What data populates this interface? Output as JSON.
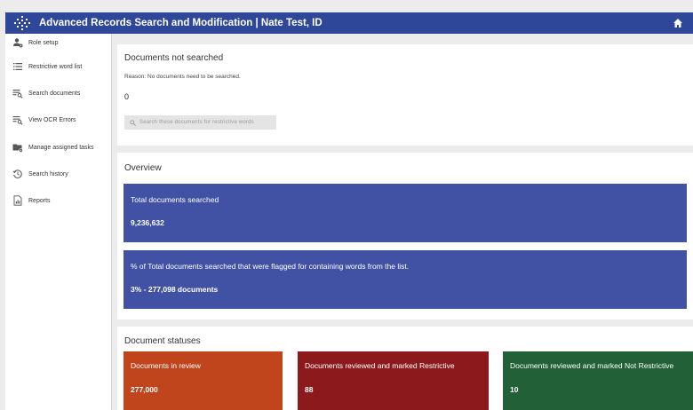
{
  "header": {
    "title": "Advanced Records Search and Modification | Nate Test, ID",
    "logo_icon": "sparkle-logo-icon",
    "home_icon": "home-icon",
    "color": "#2f4799"
  },
  "sidebar": {
    "items": [
      {
        "label": "Role setup",
        "icon": "user-settings-icon"
      },
      {
        "label": "Restrictive word list",
        "icon": "list-icon"
      },
      {
        "label": "Search documents",
        "icon": "search-list-icon"
      },
      {
        "label": "View OCR Errors",
        "icon": "search-list-icon"
      },
      {
        "label": "Manage assigned tasks",
        "icon": "folder-settings-icon"
      },
      {
        "label": "Search history",
        "icon": "history-icon"
      },
      {
        "label": "Reports",
        "icon": "report-icon"
      }
    ]
  },
  "not_searched": {
    "title": "Documents not searched",
    "reason": "Reason: No documents need to be searched.",
    "count": "0",
    "button_label": "Search these documents for restrictive words"
  },
  "overview": {
    "title": "Overview",
    "total_label": "Total documents searched",
    "total_value": "9,236,632",
    "flagged_label": "% of Total documents searched that were flagged for containing words from the list.",
    "flagged_value": "3% - 277,098 documents",
    "color": "#4152a5"
  },
  "statuses": {
    "title": "Document statuses",
    "items": [
      {
        "label": "Documents in review",
        "value": "277,000",
        "color": "#c0451c"
      },
      {
        "label": "Documents reviewed and marked Restrictive",
        "value": "88",
        "color": "#8c1a1c"
      },
      {
        "label": "Documents reviewed and marked Not Restrictive",
        "value": "10",
        "color": "#226137"
      }
    ]
  }
}
